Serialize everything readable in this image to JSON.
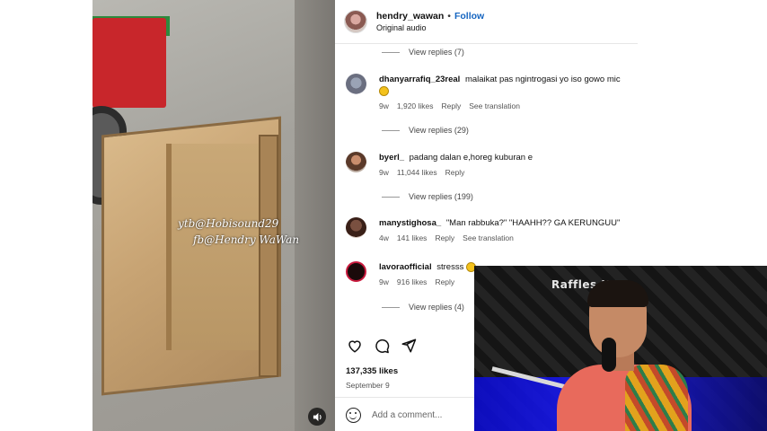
{
  "video": {
    "watermark_line1": "ytb@Hobisound29",
    "watermark_line2": "fb@Hendry WaWan",
    "sound_icon": "speaker-icon"
  },
  "header": {
    "username": "hendry_wawan",
    "separator": "•",
    "follow_label": "Follow",
    "audio": "Original audio"
  },
  "view_replies": [
    "View replies (7)",
    "View replies (29)",
    "View replies (199)",
    "View replies (4)"
  ],
  "comments": [
    {
      "user": "dhanyarrafiq_23real",
      "text": "malaikat pas ngintrogasi yo iso gowo mic",
      "time": "9w",
      "likes": "1,920 likes",
      "reply": "Reply",
      "translate": "See translation"
    },
    {
      "user": "byerl_",
      "text": "padang dalan e,horeg kuburan e",
      "time": "9w",
      "likes": "11,044 likes",
      "reply": "Reply"
    },
    {
      "user": "manystighosa_",
      "text": "\"Man rabbuka?\" \"HAAHH?? GA KERUNGUU\"",
      "time": "4w",
      "likes": "141 likes",
      "reply": "Reply",
      "translate": "See translation"
    },
    {
      "user": "lavoraofficial",
      "text": "stresss",
      "time": "9w",
      "likes": "916 likes",
      "reply": "Reply"
    }
  ],
  "post": {
    "likes": "137,335 likes",
    "date": "September 9",
    "add_comment_placeholder": "Add a comment..."
  },
  "webcam": {
    "logo_text": "Raffles Ho"
  }
}
